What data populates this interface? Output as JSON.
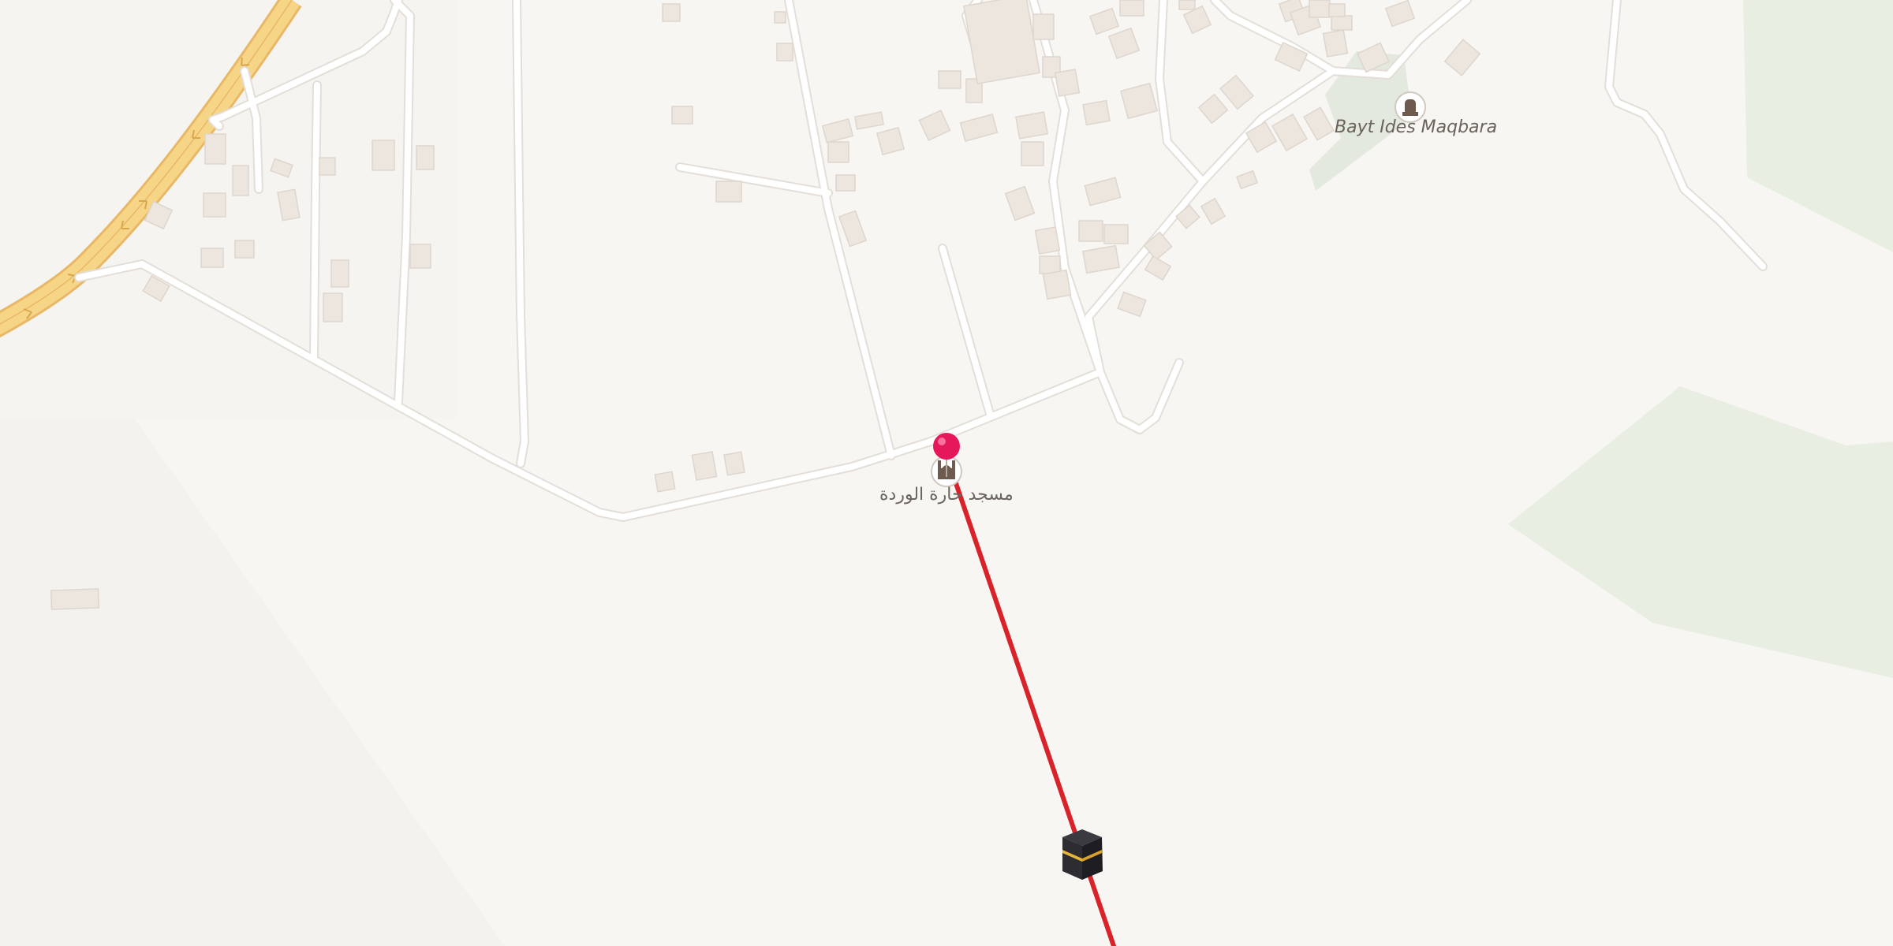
{
  "map": {
    "type": "qibla-direction-map",
    "places": [
      {
        "name": "Bayt Ides Maqbara",
        "category": "cemetery",
        "icon": "cemetery-icon"
      },
      {
        "name": "مسجد حارة الوردة",
        "category": "mosque",
        "icon": "mosque-icon"
      }
    ],
    "markers": {
      "location_pin": {
        "icon": "location-pin-icon",
        "color": "#e4185a"
      },
      "kaaba": {
        "icon": "kaaba-icon"
      }
    },
    "qibla_line": {
      "color": "#d8232a"
    },
    "colors": {
      "background": "#f7f5f1",
      "road": "#ffffff",
      "road_casing": "#e3ded8",
      "highway": "#f7d587",
      "highway_casing": "#e8b866",
      "building": "#ece6df",
      "greenery": "#e7ede0"
    }
  }
}
